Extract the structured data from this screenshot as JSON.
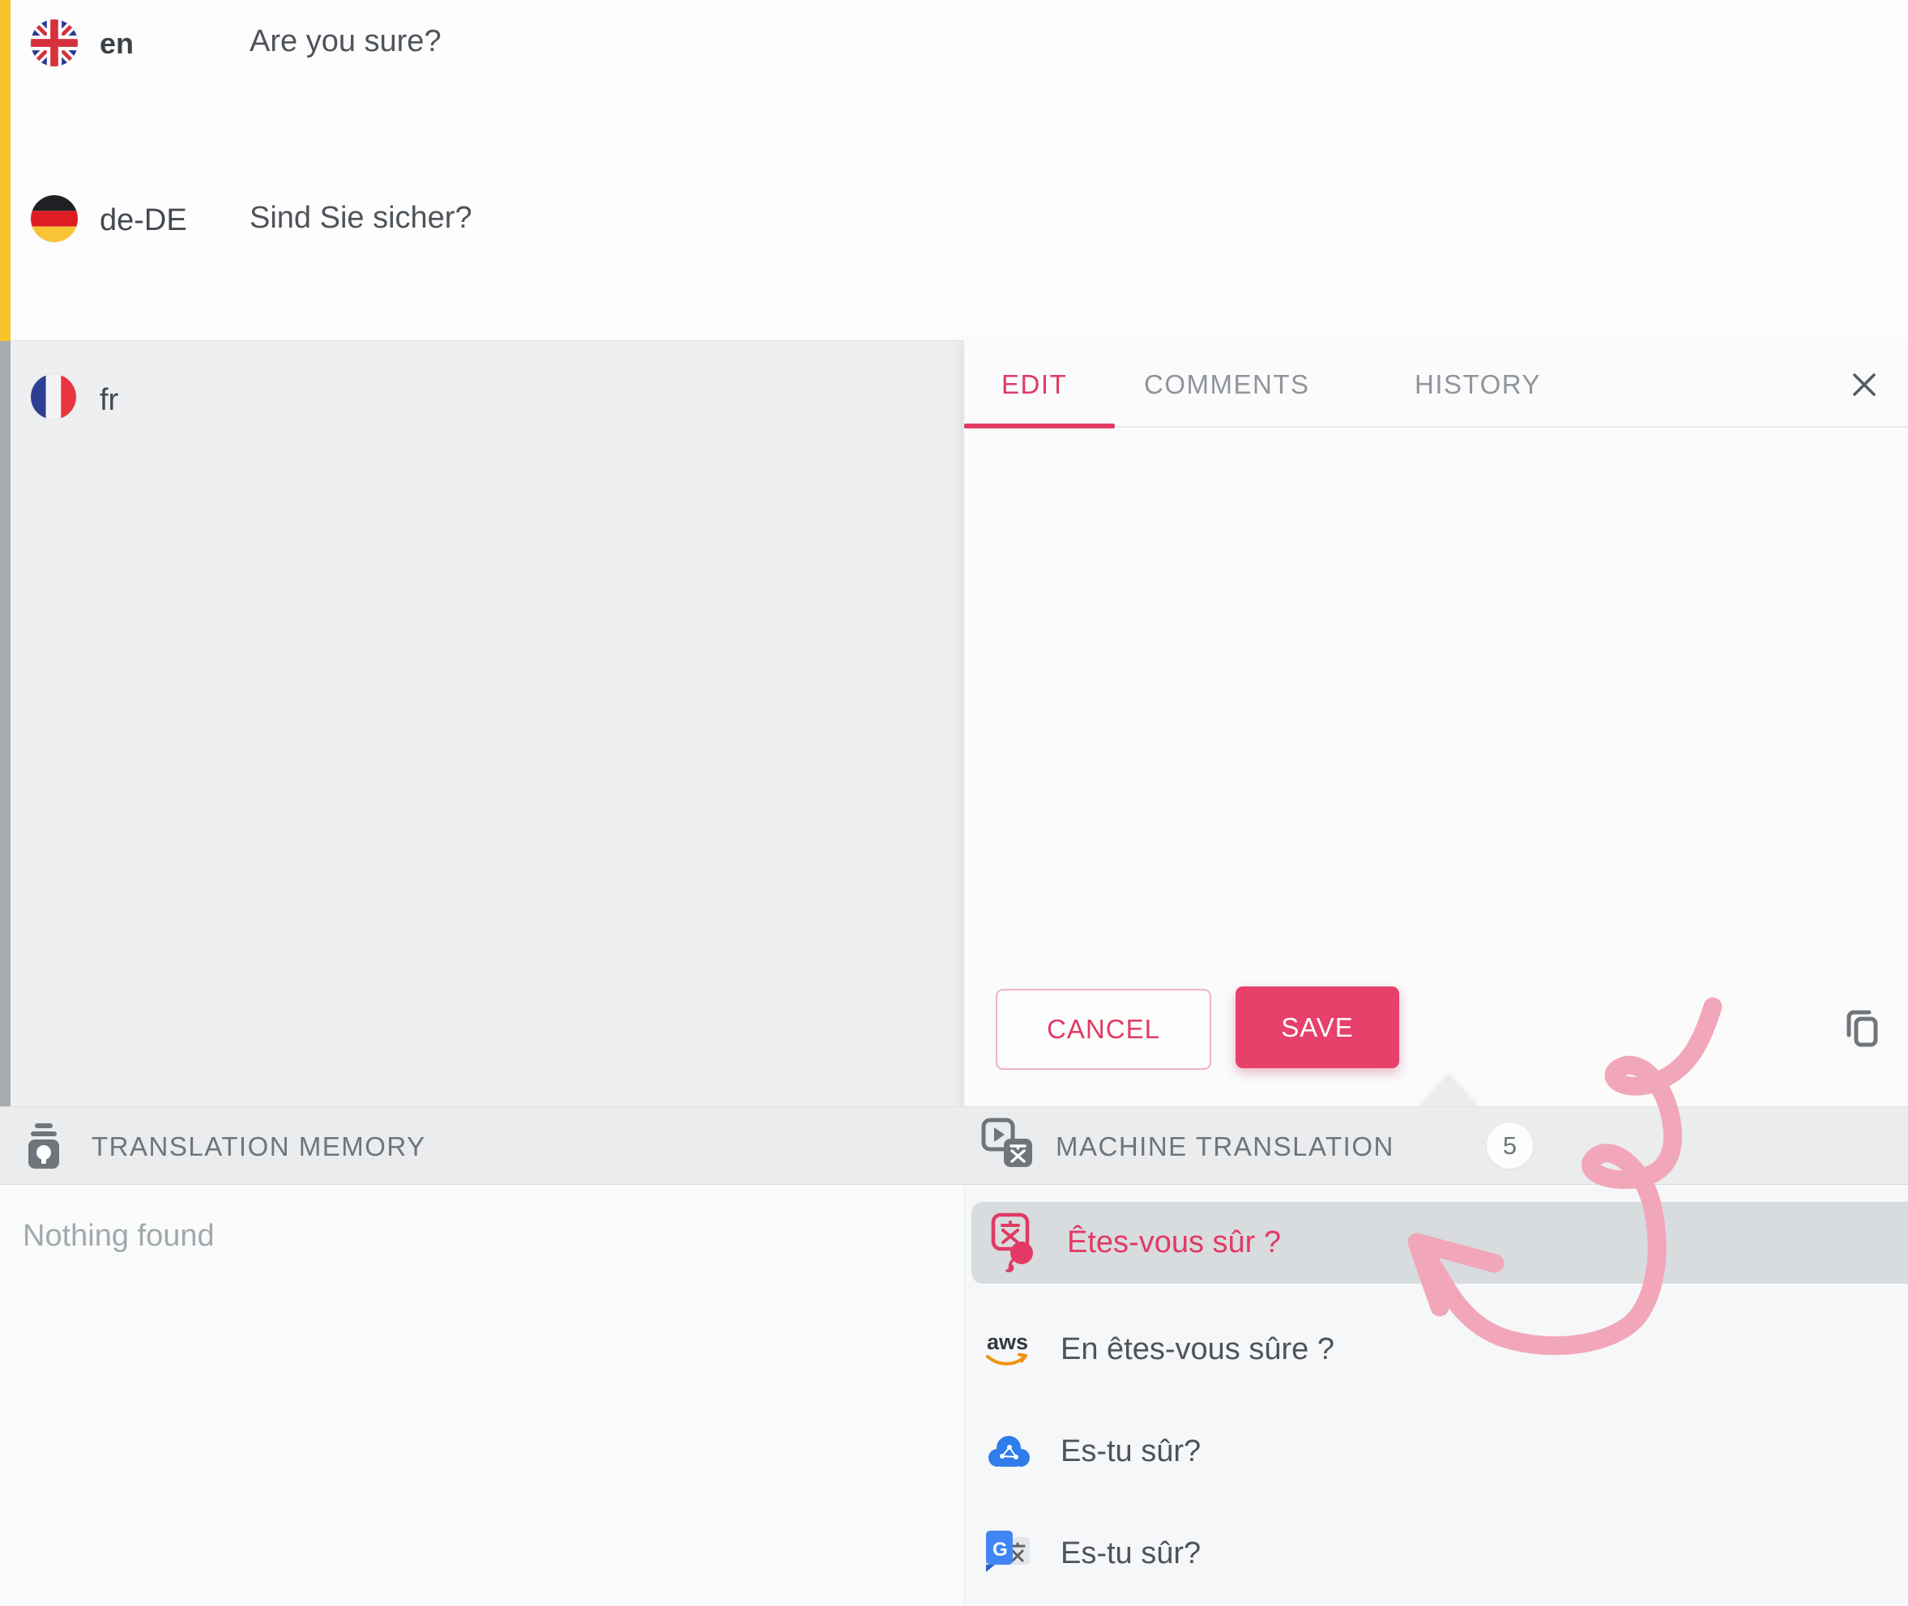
{
  "languages": [
    {
      "code": "en",
      "text": "Are you sure?"
    },
    {
      "code": "de-DE",
      "text": "Sind Sie sicher?"
    },
    {
      "code": "fr",
      "text": ""
    }
  ],
  "editor": {
    "tabs": [
      {
        "label": "EDIT",
        "active": true
      },
      {
        "label": "COMMENTS",
        "active": false
      },
      {
        "label": "HISTORY",
        "active": false
      }
    ],
    "cancel_label": "CANCEL",
    "save_label": "SAVE"
  },
  "translation_memory": {
    "title": "TRANSLATION MEMORY",
    "empty_message": "Nothing found"
  },
  "machine_translation": {
    "title": "MACHINE TRANSLATION",
    "count": "5",
    "suggestions": [
      {
        "provider": "lokalise",
        "text": "Êtes-vous sûr ?",
        "selected": true
      },
      {
        "provider": "amazon-translate",
        "text": "En êtes-vous sûre ?",
        "selected": false,
        "logo_text": "aws"
      },
      {
        "provider": "cloud-translator",
        "text": "Es-tu sûr?",
        "selected": false
      },
      {
        "provider": "google-translate",
        "text": "Es-tu sûr?",
        "selected": false,
        "logo_text": "G"
      }
    ]
  },
  "colors": {
    "accent": "#e23a64",
    "save_bg": "#e7406a",
    "yellow_bar": "#f9c32b",
    "selected_row_bg": "#d8dcdf",
    "doodle": "#f2a6ba"
  }
}
